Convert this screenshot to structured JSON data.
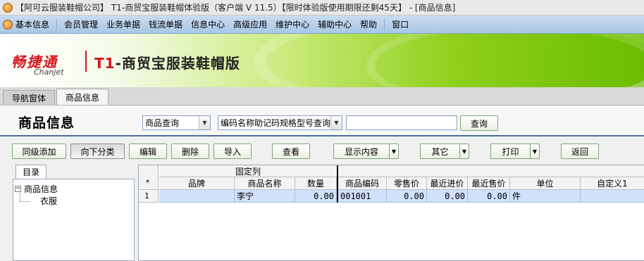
{
  "window": {
    "title": "【阿可云服装鞋帽公司】 T1-商贸宝服装鞋帽体验版（客户端 V 11.5）【限时体验版使用期限还剩45天】 - [商品信息]"
  },
  "menu": [
    "基本信息",
    "会员管理",
    "业务单据",
    "钱流单据",
    "信息中心",
    "高级应用",
    "维护中心",
    "辅助中心",
    "帮助",
    "窗口"
  ],
  "banner": {
    "logo_cn": "畅捷通",
    "logo_en": "Chanjet",
    "product_t": "T1",
    "product_rest": "-商贸宝服装鞋帽版"
  },
  "tabs": [
    "导航窗体",
    "商品信息"
  ],
  "page": {
    "title": "商品信息"
  },
  "search": {
    "mode": "商品查询",
    "field": "编码名称助记码规格型号查询",
    "value": "",
    "button": "查询"
  },
  "toolbar": {
    "same_level_add": "同级添加",
    "down_category": "向下分类",
    "edit": "编辑",
    "delete": "删除",
    "import": "导入",
    "view": "查看",
    "display": "显示内容",
    "other": "其它",
    "print": "打印",
    "back": "返回"
  },
  "tree": {
    "tab": "目录",
    "root": "商品信息",
    "child": "衣服",
    "expander": "−"
  },
  "grid": {
    "fixed_group": "固定列",
    "corner": "*",
    "columns": [
      "品牌",
      "商品名称",
      "数量",
      "商品编码",
      "零售价",
      "最近进价",
      "最近售价",
      "单位",
      "自定义1"
    ],
    "rows": [
      {
        "no": "1",
        "brand": "",
        "name": "李宁",
        "qty": "0.00",
        "code": "001001",
        "retail": "0.00",
        "last_in": "0.00",
        "last_out": "0.00",
        "unit": "件",
        "custom1": ""
      }
    ]
  }
}
